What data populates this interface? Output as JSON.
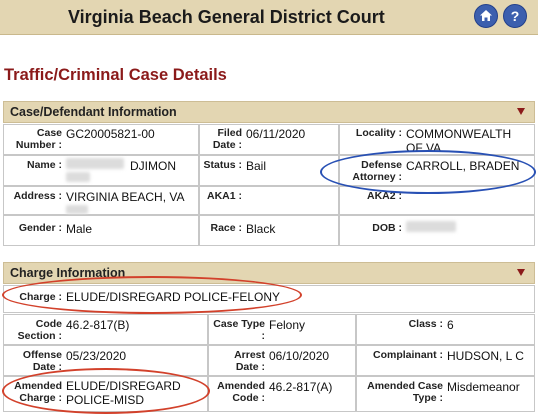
{
  "header": {
    "title": "Virginia Beach General District Court",
    "home_icon": "home-icon",
    "help_icon": "help-icon",
    "help_glyph": "?"
  },
  "page_title": "Traffic/Criminal Case Details",
  "case_section": {
    "title": "Case/Defendant Information",
    "case_number": {
      "label": "Case Number :",
      "value": "GC20005821-00"
    },
    "filed_date": {
      "label": "Filed Date :",
      "value": "06/11/2020"
    },
    "locality": {
      "label": "Locality :",
      "value": "COMMONWEALTH OF VA"
    },
    "name": {
      "label": "Name :",
      "value": "DJIMON"
    },
    "status": {
      "label": "Status :",
      "value": "Bail"
    },
    "defense_attorney": {
      "label": "Defense Attorney :",
      "value": "CARROLL, BRADEN"
    },
    "address": {
      "label": "Address :",
      "value": "VIRGINIA BEACH, VA"
    },
    "aka1": {
      "label": "AKA1 :",
      "value": ""
    },
    "aka2": {
      "label": "AKA2 :",
      "value": ""
    },
    "gender": {
      "label": "Gender :",
      "value": "Male"
    },
    "race": {
      "label": "Race :",
      "value": "Black"
    },
    "dob": {
      "label": "DOB :",
      "value": ""
    }
  },
  "charge_section": {
    "title": "Charge Information",
    "charge": {
      "label": "Charge :",
      "value": "ELUDE/DISREGARD POLICE-FELONY"
    },
    "code_section": {
      "label": "Code Section :",
      "value": "46.2-817(B)"
    },
    "case_type": {
      "label": "Case Type :",
      "value": "Felony"
    },
    "class": {
      "label": "Class :",
      "value": "6"
    },
    "offense_date": {
      "label": "Offense Date :",
      "value": "05/23/2020"
    },
    "arrest_date": {
      "label": "Arrest Date :",
      "value": "06/10/2020"
    },
    "complainant": {
      "label": "Complainant :",
      "value": "HUDSON, L C"
    },
    "amended_charge": {
      "label": "Amended Charge :",
      "value": "ELUDE/DISREGARD POLICE-MISD"
    },
    "amended_code": {
      "label": "Amended Code :",
      "value": "46.2-817(A)"
    },
    "amended_case_type": {
      "label": "Amended Case Type :",
      "value": "Misdemeanor"
    }
  },
  "colors": {
    "header_bg": "#e3d6b2",
    "title_red": "#8b1a1a",
    "circle_red": "#d2412b",
    "circle_blue": "#2850b4"
  }
}
